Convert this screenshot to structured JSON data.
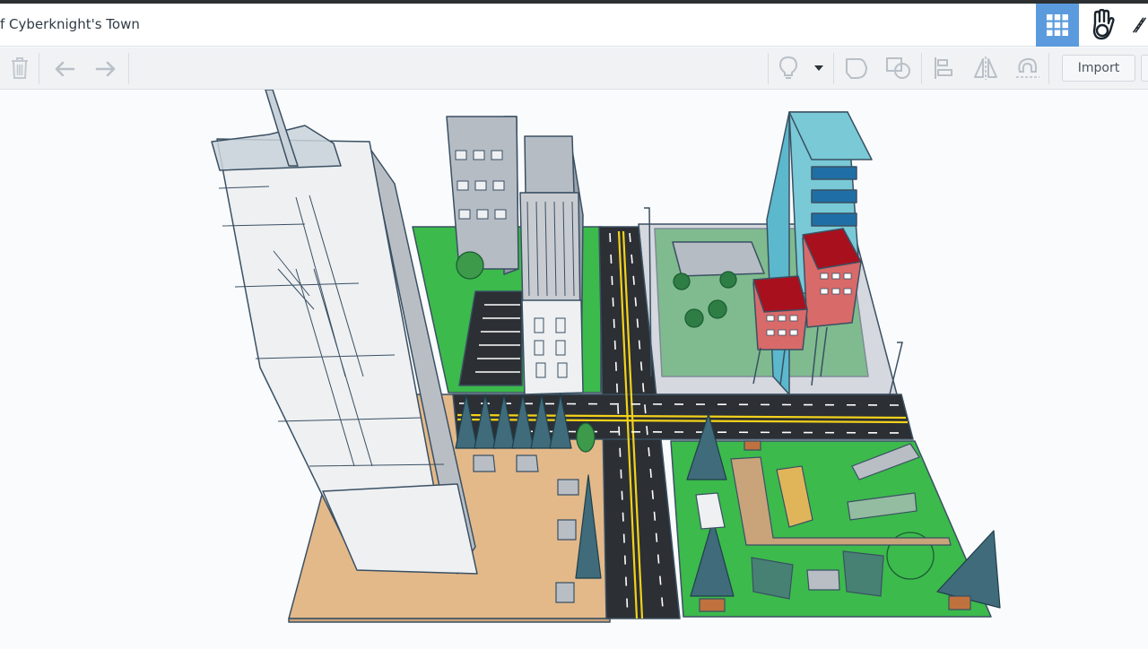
{
  "app": {
    "title": "f Cyberknight's Town"
  },
  "view_buttons": [
    {
      "icon": "grid-view-icon",
      "active": true
    },
    {
      "icon": "blocks-hand-icon",
      "active": false
    },
    {
      "icon": "bricks-icon",
      "active": false
    }
  ],
  "toolbar": {
    "left_icons": [
      "trash-icon",
      "undo-icon",
      "redo-icon"
    ],
    "right_icons": [
      "light-bulb-icon",
      "dropdown-caret-icon",
      "group-icon",
      "ungroup-icon",
      "align-icon",
      "mirror-icon",
      "cruise-icon"
    ],
    "import_label": "Import"
  },
  "scene": {
    "description_free": true,
    "colors": {
      "grass": "#3cba4c",
      "road": "#2c2f33",
      "road_line": "#f2d21b",
      "sand": "#e3b98a",
      "building_white": "#eef0f2",
      "building_gray": "#b6bcc4",
      "glass": "#79c9d6",
      "brick": "#d86a6a",
      "roof_red": "#a8101e",
      "tree": "#2e7d44",
      "pine": "#3f6b7a",
      "outline": "#3a5063"
    }
  }
}
